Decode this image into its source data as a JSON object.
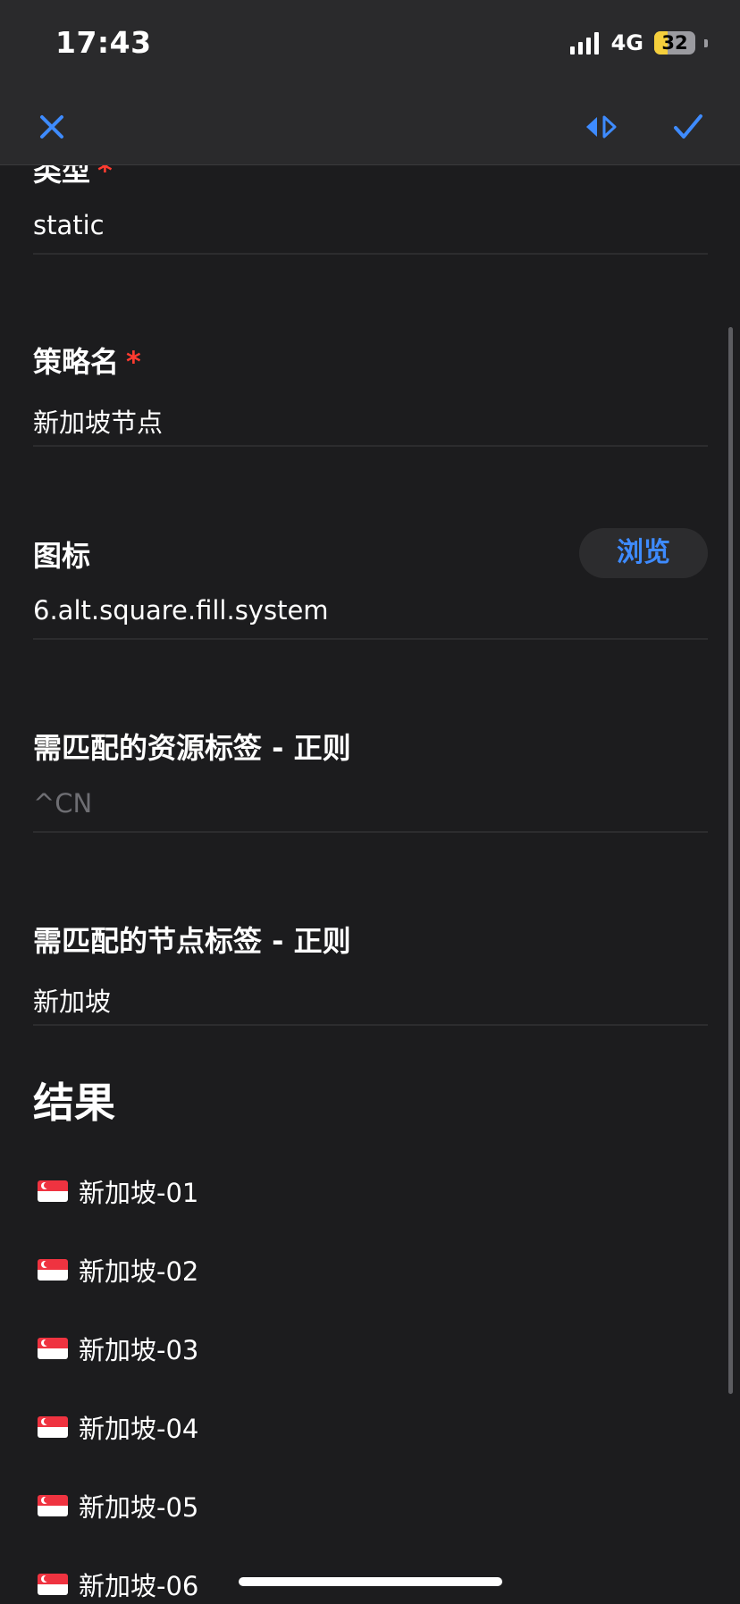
{
  "status_bar": {
    "time": "17:43",
    "network": "4G",
    "battery_percent": "32"
  },
  "nav": {
    "close_icon": "close-icon",
    "switch_icon": "toggle-direction-icon",
    "done_icon": "checkmark-icon",
    "accent_color": "#3e8bff"
  },
  "form": {
    "type": {
      "label": "类型",
      "required_mark": "*",
      "value": "static"
    },
    "policy_name": {
      "label": "策略名",
      "required_mark": "*",
      "value": "新加坡节点"
    },
    "icon": {
      "label": "图标",
      "value": "6.alt.square.fill.system",
      "browse_label": "浏览"
    },
    "resource_tag_regex": {
      "label": "需匹配的资源标签 - 正则",
      "placeholder": "^CN"
    },
    "node_tag_regex": {
      "label": "需匹配的节点标签 - 正则",
      "value": "新加坡"
    }
  },
  "results": {
    "title": "结果",
    "items": [
      {
        "flag": "singapore-flag-icon",
        "label": "新加坡-01"
      },
      {
        "flag": "singapore-flag-icon",
        "label": "新加坡-02"
      },
      {
        "flag": "singapore-flag-icon",
        "label": "新加坡-03"
      },
      {
        "flag": "singapore-flag-icon",
        "label": "新加坡-04"
      },
      {
        "flag": "singapore-flag-icon",
        "label": "新加坡-05"
      },
      {
        "flag": "singapore-flag-icon",
        "label": "新加坡-06"
      }
    ]
  }
}
